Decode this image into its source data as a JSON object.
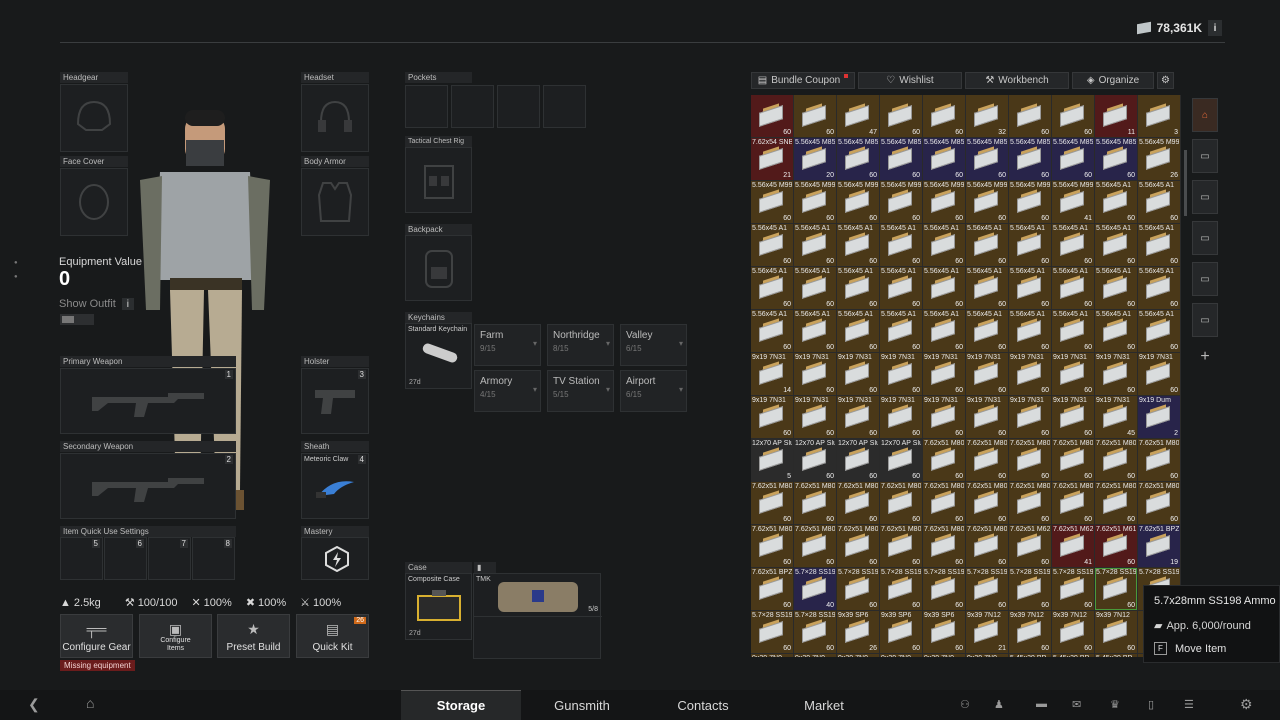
{
  "header": {
    "money": "78,361K",
    "info_label": "i"
  },
  "equipment": {
    "headgear": "Headgear",
    "headset": "Headset",
    "face_cover": "Face Cover",
    "body_armor": "Body Armor",
    "value_label": "Equipment Value",
    "value": "0",
    "show_outfit": "Show Outfit",
    "primary_weapon": "Primary Weapon",
    "primary_num": "1",
    "secondary_weapon": "Secondary Weapon",
    "secondary_num": "2",
    "holster": "Holster",
    "holster_num": "3",
    "sheath": "Sheath",
    "sheath_item": "Meteoric Claw",
    "sheath_num": "4",
    "quick_use": "Item Quick Use Settings",
    "quick_slots": [
      "5",
      "6",
      "7",
      "8"
    ],
    "mastery": "Mastery",
    "pockets": "Pockets",
    "chest_rig": "Tactical Chest Rig",
    "backpack": "Backpack",
    "keychains": "Keychains",
    "standard_keychain": "Standard Keychain",
    "keychain_days": "27d",
    "case": "Case",
    "composite_case": "Composite Case",
    "case_days": "27d",
    "tmk": "TMK",
    "tmk_count": "5/8"
  },
  "keys": [
    {
      "name": "Farm",
      "count": "9/15"
    },
    {
      "name": "Northridge",
      "count": "8/15"
    },
    {
      "name": "Valley",
      "count": "6/15"
    },
    {
      "name": "Armory",
      "count": "4/15"
    },
    {
      "name": "TV Station",
      "count": "5/15"
    },
    {
      "name": "Airport",
      "count": "6/15"
    }
  ],
  "stats": {
    "weight": "2.5kg",
    "durability": "100/100",
    "s1": "100%",
    "s2": "100%",
    "s3": "100%"
  },
  "buttons": {
    "configure_gear": "Configure Gear",
    "missing": "Missing equipment",
    "configure_items": "Configure Items",
    "preset_build": "Preset Build",
    "quick_kit": "Quick Kit",
    "quick_kit_badge": "26"
  },
  "storage_tabs": [
    "Bundle Coupon",
    "Wishlist",
    "Workbench",
    "Organize"
  ],
  "grid": {
    "cells": [
      [
        "",
        "60",
        "red"
      ],
      [
        "",
        "60",
        ""
      ],
      [
        "",
        "47",
        ""
      ],
      [
        "",
        "60",
        ""
      ],
      [
        "",
        "60",
        ""
      ],
      [
        "",
        "32",
        ""
      ],
      [
        "",
        "60",
        ""
      ],
      [
        "",
        "60",
        ""
      ],
      [
        "",
        "11",
        "red"
      ],
      [
        "",
        "3",
        ""
      ],
      [
        "7.62x54 SNB",
        "21",
        "red"
      ],
      [
        "5.56x45 M855",
        "20",
        "blue"
      ],
      [
        "5.56x45 M855",
        "60",
        "blue"
      ],
      [
        "5.56x45 M855",
        "60",
        "blue"
      ],
      [
        "5.56x45 M855",
        "60",
        "blue"
      ],
      [
        "5.56x45 M855",
        "60",
        "blue"
      ],
      [
        "5.56x45 M855",
        "60",
        "blue"
      ],
      [
        "5.56x45 M855",
        "60",
        "blue"
      ],
      [
        "5.56x45 M855",
        "60",
        "blue"
      ],
      [
        "5.56x45 M995",
        "26",
        ""
      ],
      [
        "5.56x45 M995",
        "60",
        ""
      ],
      [
        "5.56x45 M995",
        "60",
        ""
      ],
      [
        "5.56x45 M995",
        "60",
        ""
      ],
      [
        "5.56x45 M995",
        "60",
        ""
      ],
      [
        "5.56x45 M995",
        "60",
        ""
      ],
      [
        "5.56x45 M995",
        "60",
        ""
      ],
      [
        "5.56x45 M995",
        "60",
        ""
      ],
      [
        "5.56x45 M995",
        "41",
        ""
      ],
      [
        "5.56x45 A1",
        "60",
        ""
      ],
      [
        "5.56x45 A1",
        "60",
        ""
      ],
      [
        "5.56x45 A1",
        "60",
        ""
      ],
      [
        "5.56x45 A1",
        "60",
        ""
      ],
      [
        "5.56x45 A1",
        "60",
        ""
      ],
      [
        "5.56x45 A1",
        "60",
        ""
      ],
      [
        "5.56x45 A1",
        "60",
        ""
      ],
      [
        "5.56x45 A1",
        "60",
        ""
      ],
      [
        "5.56x45 A1",
        "60",
        ""
      ],
      [
        "5.56x45 A1",
        "60",
        ""
      ],
      [
        "5.56x45 A1",
        "60",
        ""
      ],
      [
        "5.56x45 A1",
        "60",
        ""
      ],
      [
        "5.56x45 A1",
        "60",
        ""
      ],
      [
        "5.56x45 A1",
        "60",
        ""
      ],
      [
        "5.56x45 A1",
        "60",
        ""
      ],
      [
        "5.56x45 A1",
        "60",
        ""
      ],
      [
        "5.56x45 A1",
        "60",
        ""
      ],
      [
        "5.56x45 A1",
        "60",
        ""
      ],
      [
        "5.56x45 A1",
        "60",
        ""
      ],
      [
        "5.56x45 A1",
        "60",
        ""
      ],
      [
        "5.56x45 A1",
        "60",
        ""
      ],
      [
        "5.56x45 A1",
        "60",
        ""
      ],
      [
        "5.56x45 A1",
        "60",
        ""
      ],
      [
        "5.56x45 A1",
        "60",
        ""
      ],
      [
        "5.56x45 A1",
        "60",
        ""
      ],
      [
        "5.56x45 A1",
        "60",
        ""
      ],
      [
        "5.56x45 A1",
        "60",
        ""
      ],
      [
        "5.56x45 A1",
        "60",
        ""
      ],
      [
        "5.56x45 A1",
        "60",
        ""
      ],
      [
        "5.56x45 A1",
        "60",
        ""
      ],
      [
        "5.56x45 A1",
        "60",
        ""
      ],
      [
        "5.56x45 A1",
        "60",
        ""
      ],
      [
        "9x19 7N31",
        "14",
        ""
      ],
      [
        "9x19 7N31",
        "60",
        ""
      ],
      [
        "9x19 7N31",
        "60",
        ""
      ],
      [
        "9x19 7N31",
        "60",
        ""
      ],
      [
        "9x19 7N31",
        "60",
        ""
      ],
      [
        "9x19 7N31",
        "60",
        ""
      ],
      [
        "9x19 7N31",
        "60",
        ""
      ],
      [
        "9x19 7N31",
        "60",
        ""
      ],
      [
        "9x19 7N31",
        "60",
        ""
      ],
      [
        "9x19 7N31",
        "60",
        ""
      ],
      [
        "9x19 7N31",
        "60",
        ""
      ],
      [
        "9x19 7N31",
        "60",
        ""
      ],
      [
        "9x19 7N31",
        "60",
        ""
      ],
      [
        "9x19 7N31",
        "60",
        ""
      ],
      [
        "9x19 7N31",
        "60",
        ""
      ],
      [
        "9x19 7N31",
        "60",
        ""
      ],
      [
        "9x19 7N31",
        "60",
        ""
      ],
      [
        "9x19 7N31",
        "60",
        ""
      ],
      [
        "9x19 7N31",
        "45",
        ""
      ],
      [
        "9x19 Dum",
        "2",
        "blue"
      ],
      [
        "12x70 AP Slug",
        "5",
        "dark"
      ],
      [
        "12x70 AP Slug",
        "60",
        "dark"
      ],
      [
        "12x70 AP Slug",
        "60",
        "dark"
      ],
      [
        "12x70 AP Slug",
        "60",
        "dark"
      ],
      [
        "7.62x51 M80",
        "60",
        ""
      ],
      [
        "7.62x51 M80",
        "60",
        ""
      ],
      [
        "7.62x51 M80",
        "60",
        ""
      ],
      [
        "7.62x51 M80",
        "60",
        ""
      ],
      [
        "7.62x51 M80",
        "60",
        ""
      ],
      [
        "7.62x51 M80",
        "60",
        ""
      ],
      [
        "7.62x51 M80",
        "60",
        ""
      ],
      [
        "7.62x51 M80",
        "60",
        ""
      ],
      [
        "7.62x51 M80",
        "60",
        ""
      ],
      [
        "7.62x51 M80",
        "60",
        ""
      ],
      [
        "7.62x51 M80",
        "60",
        ""
      ],
      [
        "7.62x51 M80",
        "60",
        ""
      ],
      [
        "7.62x51 M80",
        "60",
        ""
      ],
      [
        "7.62x51 M80",
        "60",
        ""
      ],
      [
        "7.62x51 M80",
        "60",
        ""
      ],
      [
        "7.62x51 M80",
        "60",
        ""
      ],
      [
        "7.62x51 M80",
        "60",
        ""
      ],
      [
        "7.62x51 M80",
        "60",
        ""
      ],
      [
        "7.62x51 M80",
        "60",
        ""
      ],
      [
        "7.62x51 M80",
        "60",
        ""
      ],
      [
        "7.62x51 M80",
        "60",
        ""
      ],
      [
        "7.62x51 M80",
        "60",
        ""
      ],
      [
        "7.62x51 M62",
        "60",
        ""
      ],
      [
        "7.62x51 M62",
        "41",
        "red"
      ],
      [
        "7.62x51 M61",
        "60",
        "red"
      ],
      [
        "7.62x51 BPZ",
        "19",
        "blue"
      ],
      [
        "7.62x51 BPZ",
        "60",
        ""
      ],
      [
        "5.7×28 SS190",
        "40",
        "blue"
      ],
      [
        "5.7×28 SS190",
        "60",
        ""
      ],
      [
        "5.7×28 SS190",
        "60",
        ""
      ],
      [
        "5.7×28 SS190",
        "60",
        ""
      ],
      [
        "5.7×28 SS190",
        "60",
        ""
      ],
      [
        "5.7×28 SS190",
        "60",
        ""
      ],
      [
        "5.7×28 SS198",
        "60",
        ""
      ],
      [
        "5.7×28 SS198",
        "60",
        "green"
      ],
      [
        "5.7×28 SS198",
        "",
        ""
      ],
      [
        "5.7×28 SS198",
        "60",
        ""
      ],
      [
        "5.7×28 SS198",
        "60",
        ""
      ],
      [
        "9x39 SP6",
        "26",
        ""
      ],
      [
        "9x39 SP6",
        "60",
        ""
      ],
      [
        "9x39 SP6",
        "60",
        ""
      ],
      [
        "9x39 7N12",
        "21",
        ""
      ],
      [
        "9x39 7N12",
        "60",
        ""
      ],
      [
        "9x39 7N12",
        "60",
        ""
      ],
      [
        "9x39 7N12",
        "60",
        ""
      ],
      [
        "",
        "",
        ""
      ],
      [
        "9x39 7N9",
        "",
        ""
      ],
      [
        "9x39 7N9",
        "",
        ""
      ],
      [
        "9x39 7N9",
        "",
        ""
      ],
      [
        "9x39 7N9",
        "",
        ""
      ],
      [
        "9x39 7N9",
        "",
        ""
      ],
      [
        "9x39 7N9",
        "",
        ""
      ],
      [
        "5.45x39 BP",
        "",
        ""
      ],
      [
        "5.45x39 BP",
        "",
        ""
      ],
      [
        "5.45x39 BP",
        "",
        ""
      ],
      [
        "",
        "",
        ""
      ]
    ]
  },
  "tooltip": {
    "title": "5.7x28mm SS198 Ammo",
    "price": "App. 6,000/round",
    "key": "F",
    "action": "Move Item"
  },
  "bottom_nav": [
    "Storage",
    "Gunsmith",
    "Contacts",
    "Market"
  ],
  "colors": {
    "accent_orange": "#e66a3a",
    "missing_red": "#6a1c1c",
    "badge": "#d06a1a"
  }
}
